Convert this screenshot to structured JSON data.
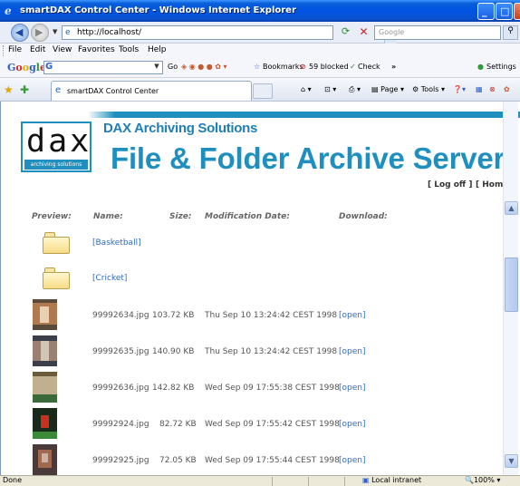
{
  "window": {
    "title": "smartDAX Control Center - Windows Internet Explorer"
  },
  "address": {
    "url": "http://localhost/",
    "search_placeholder": "Google"
  },
  "menu": [
    "File",
    "Edit",
    "View",
    "Favorites",
    "Tools",
    "Help"
  ],
  "google_toolbar": {
    "logo": "Google",
    "go": "Go",
    "bookmarks": "Bookmarks",
    "blocked": "59 blocked",
    "check": "Check",
    "more": "»",
    "settings": "Settings"
  },
  "command_bar": {
    "tab_title": "smartDAX Control Center",
    "page": "Page",
    "tools": "Tools"
  },
  "page": {
    "logo_text": "dax",
    "logo_tagline": "archiving solutions",
    "brand_sub": "DAX Archiving Solutions",
    "brand_main": "File & Folder Archive Server",
    "log_off": "[ Log off ]",
    "home": "[ Home ]",
    "headers": {
      "preview": "Preview:",
      "name": "Name:",
      "size": "Size:",
      "date": "Modification Date:",
      "download": "Download:"
    },
    "folders": [
      {
        "name": "[Basketball]"
      },
      {
        "name": "[Cricket]"
      }
    ],
    "files": [
      {
        "name": "99992634.jpg",
        "size": "103.72 KB",
        "date": "Thu Sep 10 13:24:42 CEST 1998",
        "download": "[open]",
        "thumb_colors": [
          "#5a4a3a",
          "#b07a50",
          "#e8d0b0"
        ]
      },
      {
        "name": "99992635.jpg",
        "size": "140.90 KB",
        "date": "Thu Sep 10 13:24:42 CEST 1998",
        "download": "[open]",
        "thumb_colors": [
          "#3a3f4a",
          "#9a8070",
          "#cfc6b8"
        ]
      },
      {
        "name": "99992636.jpg",
        "size": "142.82 KB",
        "date": "Wed Sep 09 17:55:38 CEST 1998",
        "download": "[open]",
        "thumb_colors": [
          "#6a5a3a",
          "#c0b090",
          "#3a6a3a"
        ]
      },
      {
        "name": "99992924.jpg",
        "size": "82.72 KB",
        "date": "Wed Sep 09 17:55:42 CEST 1998",
        "download": "[open]",
        "thumb_colors": [
          "#1a2a1a",
          "#c83020",
          "#3a8a3a"
        ]
      },
      {
        "name": "99992925.jpg",
        "size": "72.05 KB",
        "date": "Wed Sep 09 17:55:44 CEST 1998",
        "download": "[open]",
        "thumb_colors": [
          "#4a3a3a",
          "#a06a50",
          "#d0b0a0"
        ]
      }
    ]
  },
  "status": {
    "text": "Done",
    "zone": "Local intranet",
    "zoom": "100%"
  }
}
